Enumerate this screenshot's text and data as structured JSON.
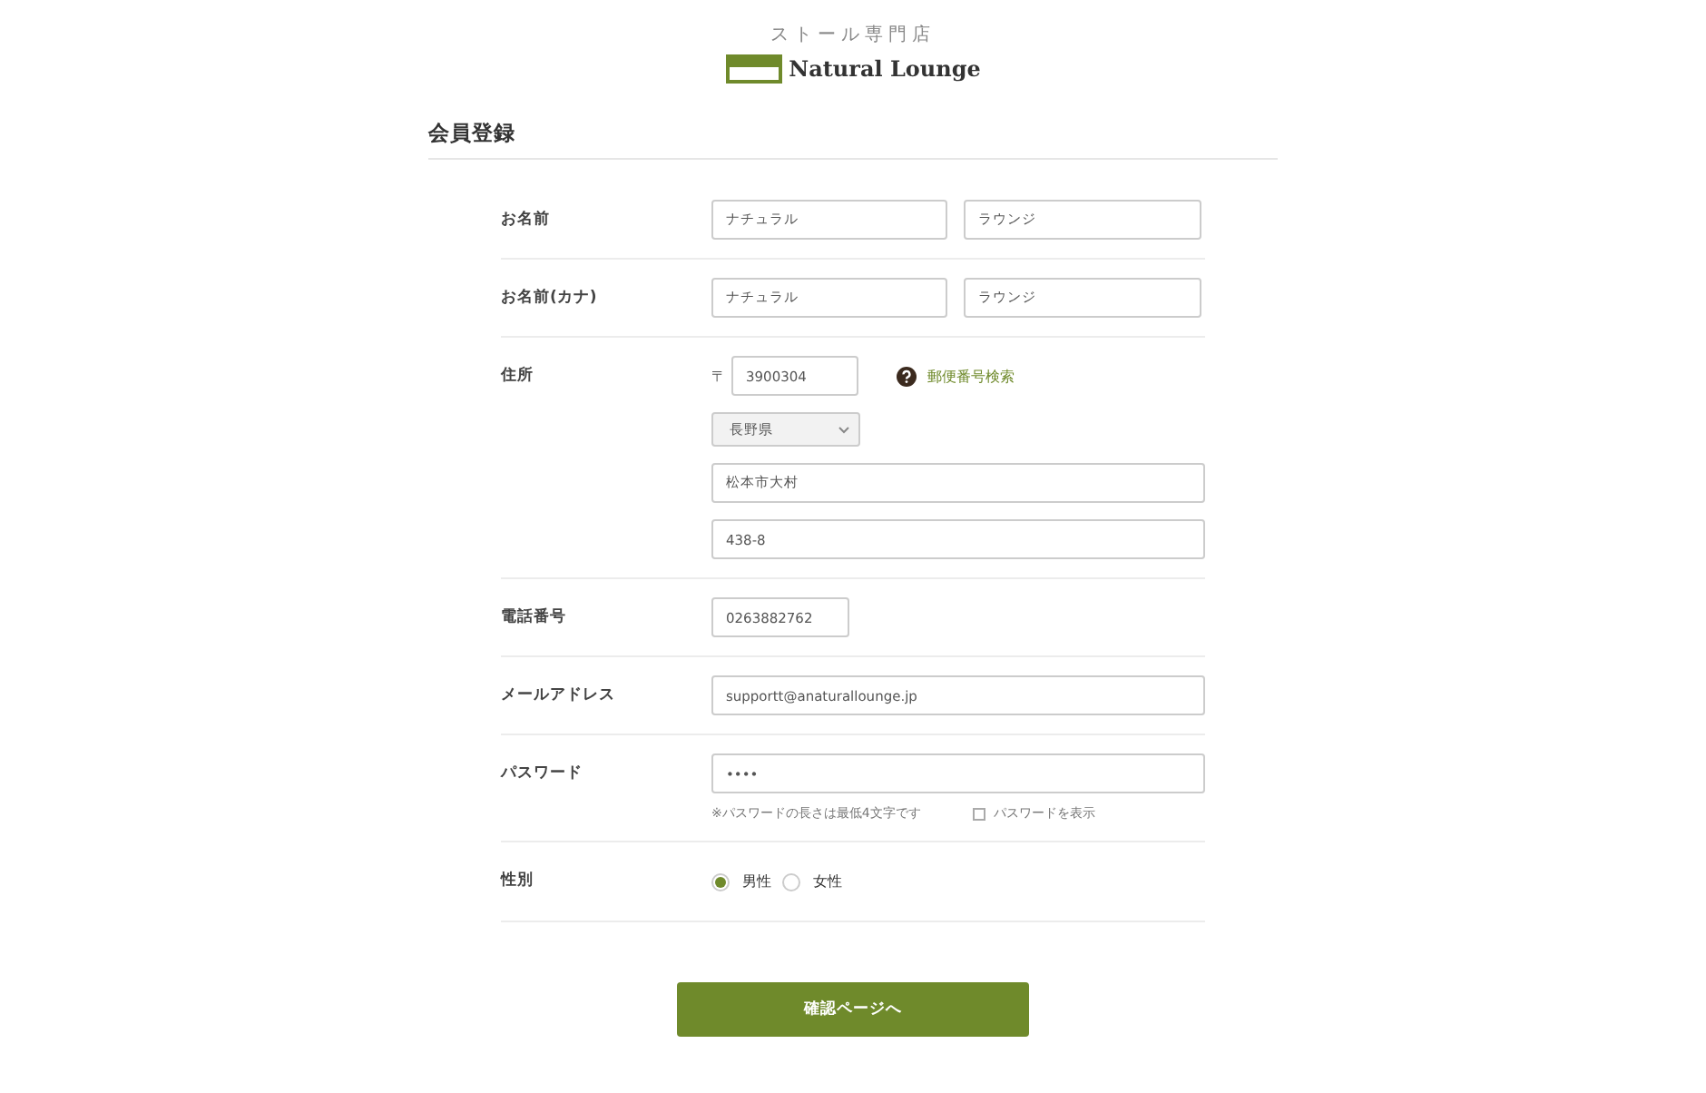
{
  "header": {
    "tagline": "ストール専門店",
    "logo_text": "Natural Lounge"
  },
  "section_title": "会員登録",
  "rows": [
    {
      "kind": "pair",
      "label": "お名前",
      "values": [
        "ナチュラル",
        "ラウンジ"
      ]
    },
    {
      "kind": "pair",
      "label": "お名前(カナ)",
      "values": [
        "ナチュラル",
        "ラウンジ"
      ]
    },
    {
      "kind": "address",
      "label": "住所",
      "postal_mark": "〒",
      "postal_code": "3900304",
      "lookup_link": "郵便番号検索",
      "prefecture": "長野県",
      "lines": [
        "松本市大村",
        "438-8"
      ]
    },
    {
      "kind": "short",
      "label": "電話番号",
      "value": "0263882762"
    },
    {
      "kind": "wide",
      "label": "メールアドレス",
      "value": "supportt@anaturallounge.jp"
    },
    {
      "kind": "password",
      "label": "パスワード",
      "value": "••••",
      "note": "※パスワードの長さは最低4文字です",
      "show_label": "パスワードを表示",
      "show_checked": false
    },
    {
      "kind": "radio",
      "label": "性別",
      "options": [
        {
          "label": "男性",
          "selected": true
        },
        {
          "label": "女性",
          "selected": false
        }
      ]
    }
  ],
  "submit_button": "確認ページへ"
}
